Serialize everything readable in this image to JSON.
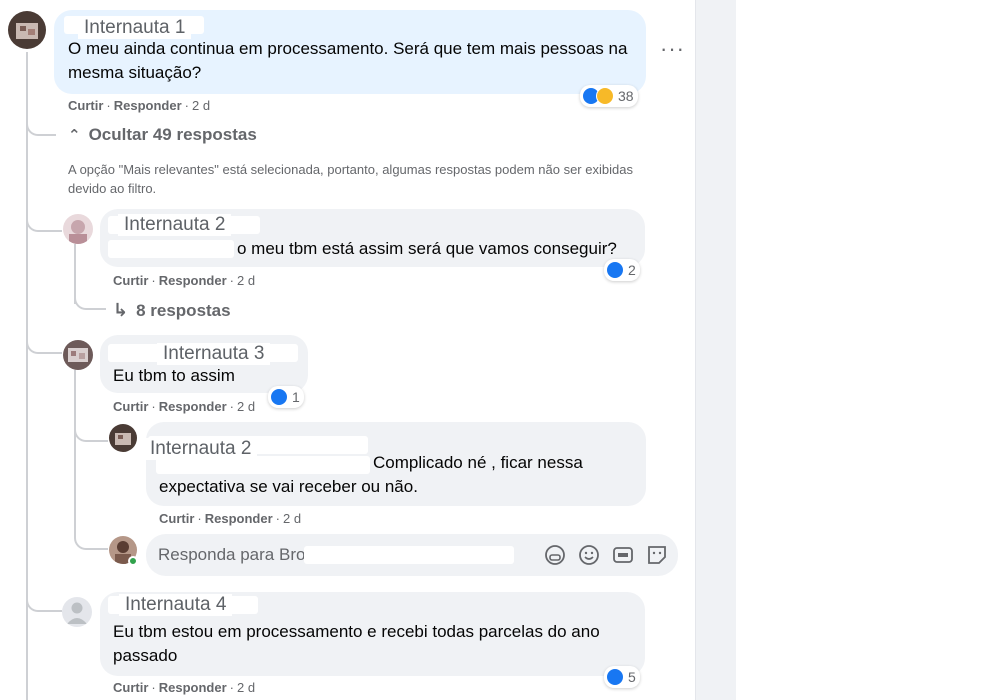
{
  "comment_main": {
    "author": "Internauta 1",
    "text": "O meu ainda continua em processamento. Será que tem mais pessoas na mesma situação?",
    "like_label": "Curtir",
    "reply_label": "Responder",
    "time": "2 d",
    "reaction_count": "38",
    "more_label": "···"
  },
  "hide_replies_label": "Ocultar 49 respostas",
  "filter_notice": "A opção \"Mais relevantes\" está selecionada, portanto, algumas respostas podem não ser exibidas devido ao filtro.",
  "replies": [
    {
      "author": "Internauta 2",
      "text": "o meu tbm está assim será que vamos conseguir?",
      "like_label": "Curtir",
      "reply_label": "Responder",
      "time": "2 d",
      "reaction_count": "2",
      "sub_replies_label": "8 respostas"
    },
    {
      "author": "Internauta 3",
      "text": "Eu tbm to assim",
      "like_label": "Curtir",
      "reply_label": "Responder",
      "time": "2 d",
      "reaction_count": "1"
    },
    {
      "author": "Internauta 2",
      "text": "Complicado né , ficar nessa expectativa se vai receber ou não.",
      "like_label": "Curtir",
      "reply_label": "Responder",
      "time": "2 d"
    },
    {
      "author": "Internauta 4",
      "text": "Eu tbm estou em processamento e recebi todas parcelas do ano passado",
      "like_label": "Curtir",
      "reply_label": "Responder",
      "time": "2 d",
      "reaction_count": "5"
    }
  ],
  "reply_input": {
    "placeholder": "Responda para Bro"
  },
  "colors": {
    "like_blue": "#1877f2",
    "haha_yellow": "#f7b928",
    "bubble_gray": "#f0f2f5",
    "bubble_highlight": "#e7f3ff",
    "online_green": "#31a24c"
  }
}
